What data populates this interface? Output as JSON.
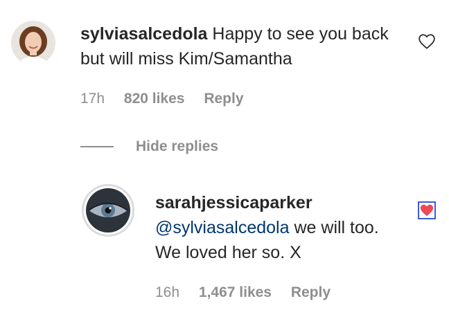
{
  "comment": {
    "username": "sylviasalcedola",
    "text": "Happy to see you back but will miss Kim/Samantha",
    "time": "17h",
    "likes": "820 likes",
    "reply_label": "Reply"
  },
  "thread": {
    "hide_replies_label": "Hide replies"
  },
  "reply": {
    "username": "sarahjessicaparker",
    "mention": "@sylviasalcedola",
    "text": "we will too. We loved her so. X",
    "time": "16h",
    "likes": "1,467 likes",
    "reply_label": "Reply"
  },
  "icons": {
    "comment_like": "heart-outline-icon",
    "reply_like": "heart-filled-icon"
  },
  "colors": {
    "text": "#262626",
    "secondary": "#8e8e8e",
    "mention": "#00376b",
    "liked_heart": "#ed4956"
  }
}
